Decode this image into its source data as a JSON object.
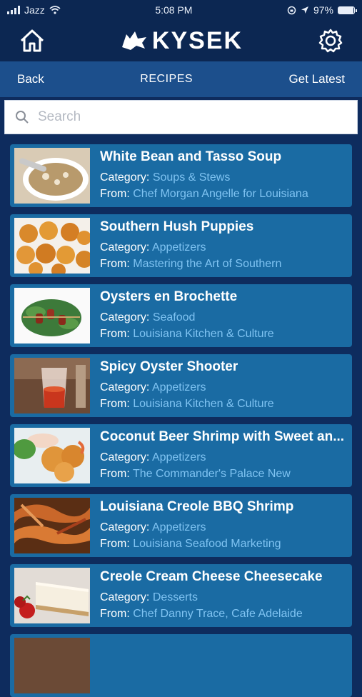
{
  "status": {
    "carrier": "Jazz",
    "time": "5:08 PM",
    "battery": "97%",
    "battery_level": 0.97
  },
  "header": {
    "brand": "KYSEK",
    "home_icon": "home-icon",
    "settings_icon": "gear-icon"
  },
  "nav": {
    "back": "Back",
    "title": "RECIPES",
    "get_latest": "Get Latest"
  },
  "search": {
    "placeholder": "Search"
  },
  "labels": {
    "category": "Category:",
    "from": "From:"
  },
  "recipes": [
    {
      "name": "White Bean and Tasso Soup",
      "category": "Soups & Stews",
      "from": "Chef Morgan Angelle for Louisiana"
    },
    {
      "name": "Southern Hush Puppies",
      "category": "Appetizers",
      "from": "Mastering the Art of Southern"
    },
    {
      "name": "Oysters en Brochette",
      "category": "Seafood",
      "from": "Louisiana Kitchen & Culture"
    },
    {
      "name": "Spicy Oyster Shooter",
      "category": "Appetizers",
      "from": "Louisiana Kitchen & Culture"
    },
    {
      "name": "Coconut Beer Shrimp with Sweet an...",
      "category": "Appetizers",
      "from": "The Commander's Palace New"
    },
    {
      "name": "Louisiana Creole BBQ Shrimp",
      "category": "Appetizers",
      "from": "Louisiana Seafood Marketing"
    },
    {
      "name": "Creole Cream Cheese Cheesecake",
      "category": "Desserts",
      "from": "Chef Danny Trace, Cafe Adelaide"
    }
  ]
}
